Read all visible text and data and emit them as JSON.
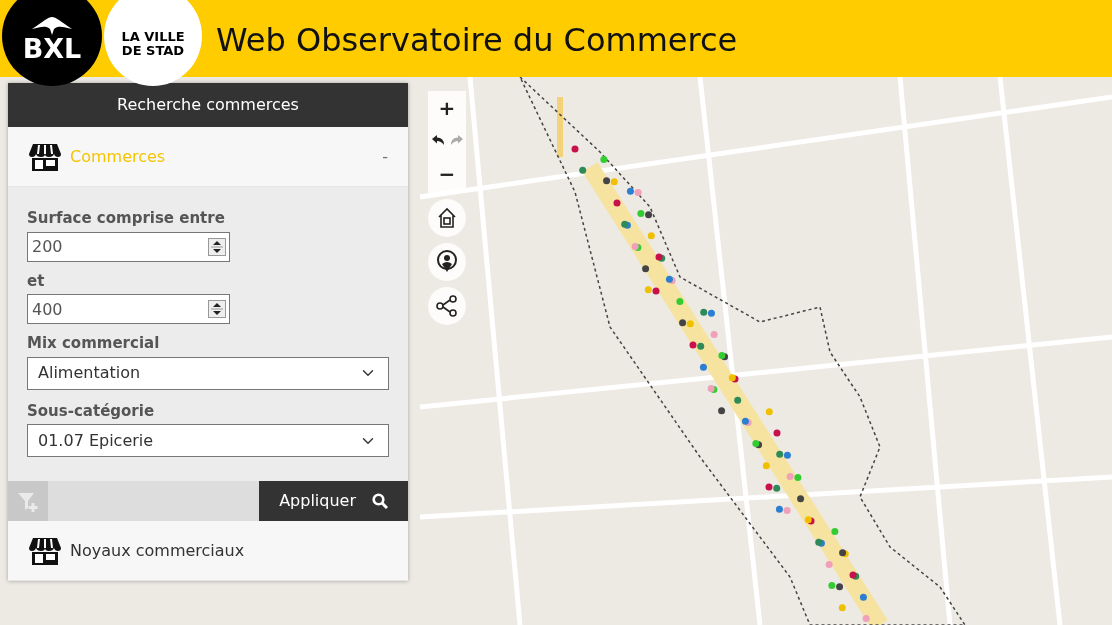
{
  "header": {
    "logo_black": "BXL",
    "logo_white": [
      "LA VILLE",
      "DE STAD"
    ],
    "title": "Web Observatoire du Commerce"
  },
  "map_controls": [
    {
      "kind": "zoom-in",
      "label": "+"
    },
    {
      "kind": "history"
    },
    {
      "kind": "zoom-out",
      "label": "−"
    },
    {
      "kind": "home"
    },
    {
      "kind": "locate"
    },
    {
      "kind": "share"
    }
  ],
  "redo_disabled": true,
  "panel": {
    "title": "Recherche commerces",
    "sections": [
      {
        "label": "Commerces",
        "expanded": true,
        "toggle": "-"
      },
      {
        "label": "Noyaux commerciaux",
        "expanded": false
      }
    ],
    "form": [
      {
        "kind": "number",
        "label": "Surface comprise entre",
        "value": "200"
      },
      {
        "kind": "number",
        "label": "et",
        "value": "400"
      },
      {
        "kind": "select",
        "label": "Mix commercial",
        "value": "Alimentation"
      },
      {
        "kind": "select",
        "label": "Sous-catégorie",
        "value": "01.07 Epicerie"
      }
    ],
    "filter_button_disabled": true,
    "apply_button": "Appliquer"
  }
}
